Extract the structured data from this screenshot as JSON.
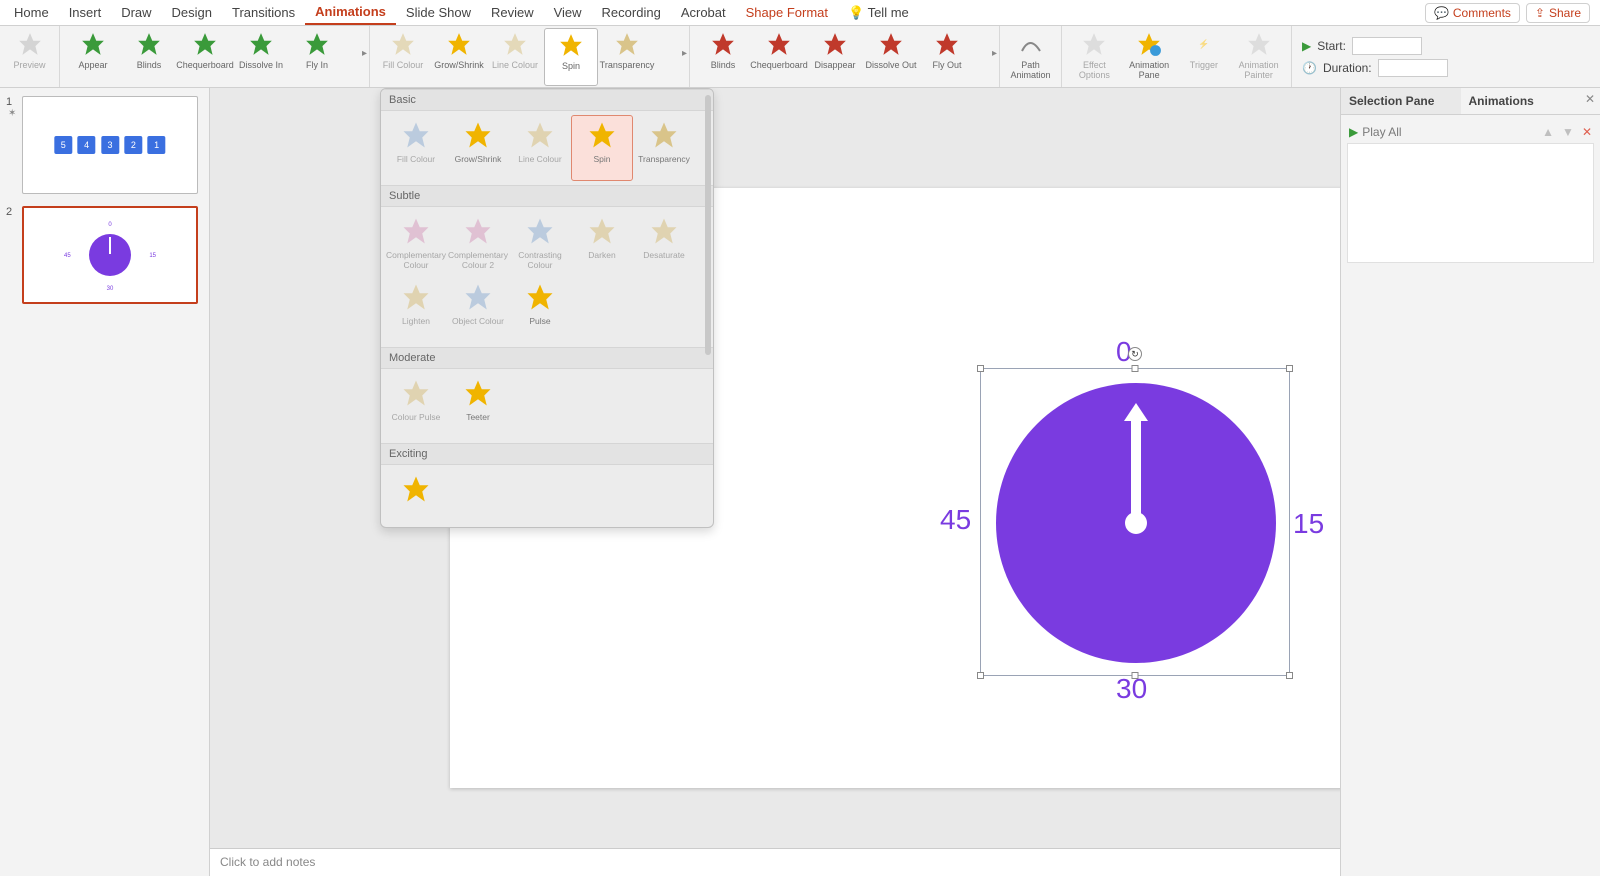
{
  "tabs": {
    "items": [
      "Home",
      "Insert",
      "Draw",
      "Design",
      "Transitions",
      "Animations",
      "Slide Show",
      "Review",
      "View",
      "Recording",
      "Acrobat",
      "Shape Format",
      "Tell me"
    ],
    "active": "Animations",
    "comments": "Comments",
    "share": "Share"
  },
  "ribbon": {
    "preview": "Preview",
    "entrance": [
      "Appear",
      "Blinds",
      "Chequerboard",
      "Dissolve In",
      "Fly In"
    ],
    "emphasis": [
      "Fill Colour",
      "Grow/Shrink",
      "Line Colour",
      "Spin",
      "Transparency"
    ],
    "exit": [
      "Blinds",
      "Chequerboard",
      "Disappear",
      "Dissolve Out",
      "Fly Out"
    ],
    "tools": {
      "path": "Path Animation",
      "effect": "Effect Options",
      "pane": "Animation Pane",
      "trigger": "Trigger",
      "painter": "Animation Painter"
    },
    "timing": {
      "start_label": "Start:",
      "start_value": "",
      "duration_label": "Duration:",
      "duration_value": ""
    }
  },
  "gallery": {
    "sections": {
      "basic": {
        "title": "Basic",
        "items": [
          "Fill Colour",
          "Grow/Shrink",
          "Line Colour",
          "Spin",
          "Transparency"
        ],
        "selected": "Spin"
      },
      "subtle": {
        "title": "Subtle",
        "items": [
          "Complementary Colour",
          "Complementary Colour 2",
          "Contrasting Colour",
          "Darken",
          "Desaturate",
          "Lighten",
          "Object Colour",
          "Pulse"
        ]
      },
      "moderate": {
        "title": "Moderate",
        "items": [
          "Colour Pulse",
          "Teeter"
        ]
      },
      "exciting": {
        "title": "Exciting",
        "items": [
          ""
        ]
      }
    }
  },
  "thumbs": {
    "slide1": {
      "num": "1",
      "tiles": [
        "5",
        "4",
        "3",
        "2",
        "1"
      ]
    },
    "slide2": {
      "num": "2"
    }
  },
  "clock": {
    "n0": "0",
    "n15": "15",
    "n30": "30",
    "n45": "45"
  },
  "notes": {
    "placeholder": "Click to add notes"
  },
  "sidepane": {
    "tab1": "Selection Pane",
    "tab2": "Animations",
    "playall": "Play All"
  }
}
